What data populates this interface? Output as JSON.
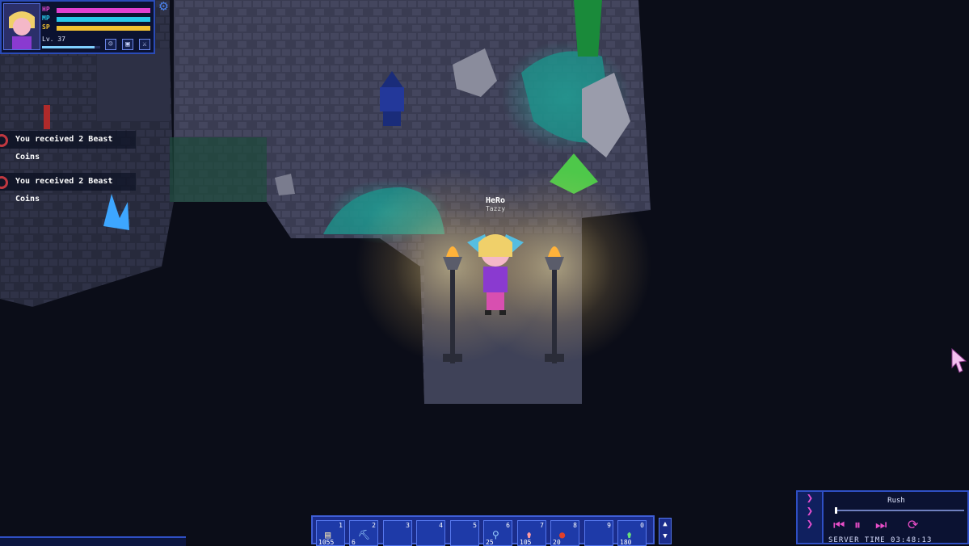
{
  "player": {
    "stats": [
      {
        "label": "HP",
        "color": "#e040d0",
        "fraction": 1.0
      },
      {
        "label": "MP",
        "color": "#28c8e8",
        "fraction": 1.0
      },
      {
        "label": "SP",
        "color": "#f0c030",
        "fraction": 1.0
      }
    ],
    "level_text": "Lv. 37",
    "xp_fraction": 0.9,
    "buttons": [
      "profile-icon",
      "inventory-icon",
      "skills-icon"
    ]
  },
  "notifications": [
    {
      "text": "You received 2 Beast Coins"
    },
    {
      "text": "You received 2 Beast Coins"
    }
  ],
  "character": {
    "name": "HeRo",
    "subtitle": "Tazzy"
  },
  "hotbar": {
    "slots": [
      {
        "number": "1",
        "count": "1055",
        "icon": "scroll-icon"
      },
      {
        "number": "2",
        "count": "6",
        "icon": "pickaxe-icon"
      },
      {
        "number": "3",
        "count": "",
        "icon": ""
      },
      {
        "number": "4",
        "count": "",
        "icon": ""
      },
      {
        "number": "5",
        "count": "",
        "icon": ""
      },
      {
        "number": "6",
        "count": "25",
        "icon": "tool-icon"
      },
      {
        "number": "7",
        "count": "105",
        "icon": "potion-icon"
      },
      {
        "number": "8",
        "count": "20",
        "icon": "apple-icon"
      },
      {
        "number": "9",
        "count": "",
        "icon": ""
      },
      {
        "number": "0",
        "count": "180",
        "icon": "green-potion-icon"
      }
    ],
    "scroll_up": "▲",
    "scroll_down": "▼"
  },
  "music": {
    "track": "Rush",
    "progress_fraction": 0.0,
    "server_time": "SERVER TIME  03:48:13",
    "accent": "#e94ec8"
  }
}
